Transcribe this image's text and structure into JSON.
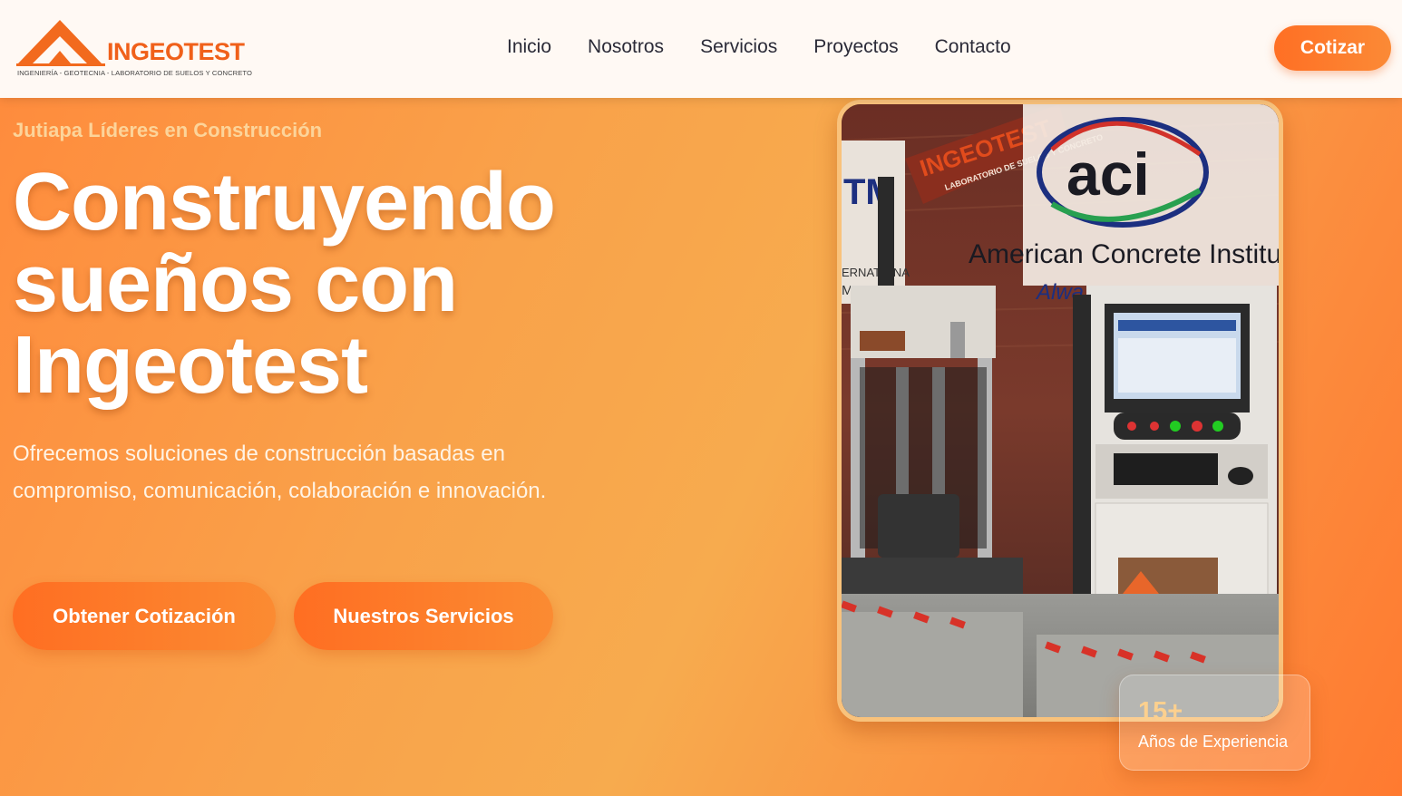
{
  "brand": {
    "name": "INGEOTEST",
    "tagline": "INGENIERÍA - GEOTECNIA - LABORATORIO DE SUELOS Y CONCRETO",
    "logo_icon": "roof-triangle-icon"
  },
  "nav": {
    "items": [
      "Inicio",
      "Nosotros",
      "Servicios",
      "Proyectos",
      "Contacto"
    ],
    "cta": "Cotizar"
  },
  "hero": {
    "eyebrow": "Jutiapa Líderes en Construcción",
    "headline": "Construyendo sueños con Ingeotest",
    "subtitle": "Ofrecemos soluciones de construcción basadas en compromiso, comunicación, colaboración e innovación.",
    "primary_cta": "Obtener Cotización",
    "secondary_cta": "Nuestros Servicios"
  },
  "photo": {
    "sign_text": "American Concrete Institu",
    "sign_sub": "Alwa",
    "logo_text": "aci",
    "banner_text": "INGEOTEST",
    "banner_sub": "LABORATORIO DE SUELOS Y CONCRETO",
    "left_text_1": "ERNATIONA",
    "left_text_2": "MBE"
  },
  "stats": {
    "value": "15+",
    "label": "Años de Experiencia"
  },
  "colors": {
    "brand_orange": "#f0601a",
    "button_orange": "#ff6f24",
    "accent_peach": "#fcd49a"
  }
}
